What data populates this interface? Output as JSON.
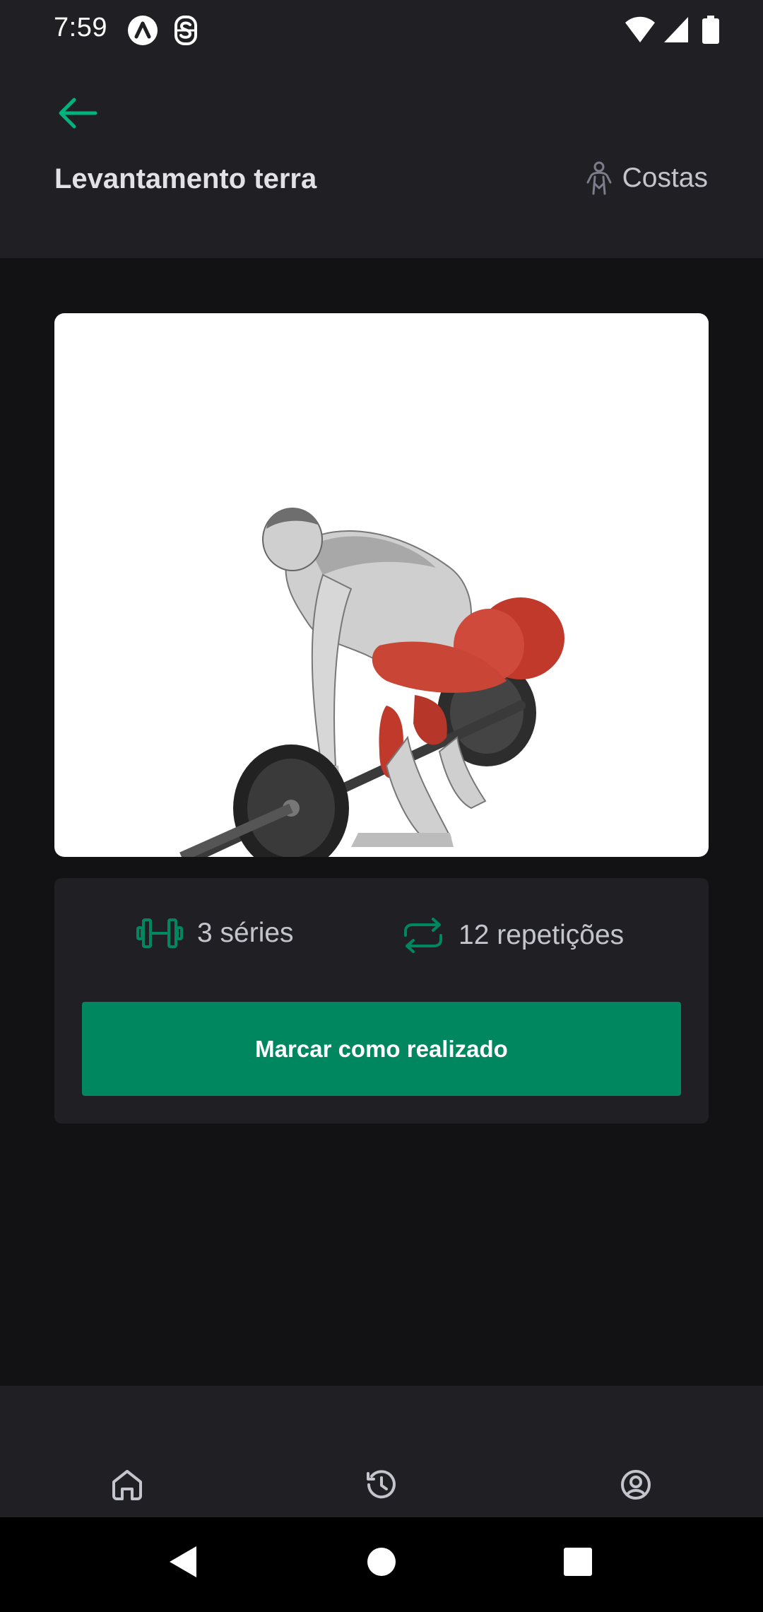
{
  "status_bar": {
    "time": "7:59",
    "icons": [
      "app-a-icon",
      "app-s-icon",
      "wifi-icon",
      "cell-signal-icon",
      "battery-icon"
    ]
  },
  "header": {
    "back_icon": "arrow-left-icon",
    "title": "Levantamento terra",
    "group_icon": "body-icon",
    "group_label": "Costas"
  },
  "exercise": {
    "image": "deadlift-illustration",
    "series_icon": "dumbbell-icon",
    "series_label": "3 séries",
    "reps_icon": "repeat-icon",
    "reps_label": "12 repetições",
    "done_button_label": "Marcar como realizado"
  },
  "tab_bar": {
    "tabs": [
      {
        "icon": "home-icon"
      },
      {
        "icon": "history-icon"
      },
      {
        "icon": "profile-icon"
      }
    ]
  },
  "colors": {
    "accent": "#00875f",
    "accent_light": "#00b37e",
    "background": "#121214",
    "surface": "#202024",
    "text": "#e1e1e6",
    "muted_text": "#c4c4cc"
  }
}
